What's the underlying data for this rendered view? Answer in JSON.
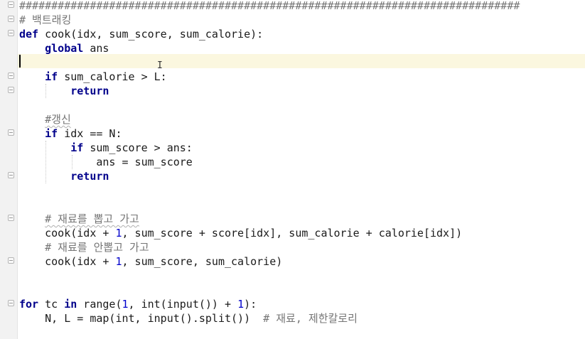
{
  "editor": {
    "lines": [
      {
        "indent": "",
        "tokens": [
          {
            "t": "##############################################################################",
            "c": "cm"
          }
        ]
      },
      {
        "indent": "",
        "tokens": [
          {
            "t": "# 백트래킹",
            "c": "cm"
          }
        ]
      },
      {
        "indent": "",
        "tokens": [
          {
            "t": "def",
            "c": "kw"
          },
          {
            "t": " cook(idx, sum_score, sum_calorie):",
            "c": ""
          }
        ]
      },
      {
        "indent": "    ",
        "tokens": [
          {
            "t": "global",
            "c": "kw"
          },
          {
            "t": " ans",
            "c": ""
          }
        ]
      },
      {
        "indent": "",
        "tokens": []
      },
      {
        "indent": "    ",
        "tokens": [
          {
            "t": "if",
            "c": "kw"
          },
          {
            "t": " sum_calorie > L:",
            "c": ""
          }
        ]
      },
      {
        "indent": "        ",
        "tokens": [
          {
            "t": "return",
            "c": "kw"
          }
        ]
      },
      {
        "indent": "",
        "tokens": []
      },
      {
        "indent": "    ",
        "tokens": [
          {
            "t": "#갱신",
            "c": "cm ws"
          }
        ]
      },
      {
        "indent": "    ",
        "tokens": [
          {
            "t": "if",
            "c": "kw"
          },
          {
            "t": " idx == N:",
            "c": ""
          }
        ]
      },
      {
        "indent": "        ",
        "tokens": [
          {
            "t": "if",
            "c": "kw"
          },
          {
            "t": " sum_score > ans:",
            "c": ""
          }
        ]
      },
      {
        "indent": "            ",
        "tokens": [
          {
            "t": "ans = sum_score",
            "c": ""
          }
        ]
      },
      {
        "indent": "        ",
        "tokens": [
          {
            "t": "return",
            "c": "kw"
          }
        ]
      },
      {
        "indent": "",
        "tokens": []
      },
      {
        "indent": "",
        "tokens": []
      },
      {
        "indent": "    ",
        "tokens": [
          {
            "t": "# 재료를 뽑고 가고",
            "c": "cm ws"
          }
        ]
      },
      {
        "indent": "    ",
        "tokens": [
          {
            "t": "cook(idx + ",
            "c": ""
          },
          {
            "t": "1",
            "c": "num"
          },
          {
            "t": ", sum_score + score[idx], sum_calorie + calorie[idx])",
            "c": ""
          }
        ]
      },
      {
        "indent": "    ",
        "tokens": [
          {
            "t": "# 재료를 안뽑고 가고",
            "c": "cm"
          }
        ]
      },
      {
        "indent": "    ",
        "tokens": [
          {
            "t": "cook(idx + ",
            "c": ""
          },
          {
            "t": "1",
            "c": "num"
          },
          {
            "t": ", sum_score, sum_calorie)",
            "c": ""
          }
        ]
      },
      {
        "indent": "",
        "tokens": []
      },
      {
        "indent": "",
        "tokens": []
      },
      {
        "indent": "",
        "tokens": [
          {
            "t": "for",
            "c": "kw"
          },
          {
            "t": " tc ",
            "c": ""
          },
          {
            "t": "in",
            "c": "kw"
          },
          {
            "t": " range(",
            "c": ""
          },
          {
            "t": "1",
            "c": "num"
          },
          {
            "t": ", int(input()) + ",
            "c": ""
          },
          {
            "t": "1",
            "c": "num"
          },
          {
            "t": "):",
            "c": ""
          }
        ]
      },
      {
        "indent": "    ",
        "tokens": [
          {
            "t": "N, L = map(int, input().split())  ",
            "c": ""
          },
          {
            "t": "# 재료, 제한칼로리",
            "c": "cm"
          }
        ]
      }
    ]
  }
}
